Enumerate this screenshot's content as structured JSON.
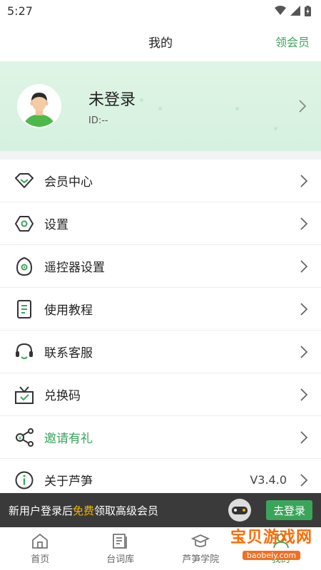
{
  "status_bar": {
    "time": "5:27"
  },
  "header": {
    "title": "我的",
    "action": "领会员"
  },
  "profile": {
    "name": "未登录",
    "id": "ID:--"
  },
  "menu": [
    {
      "label": "会员中心",
      "icon": "diamond-icon",
      "highlight": false,
      "value": ""
    },
    {
      "label": "设置",
      "icon": "hexagon-settings-icon",
      "highlight": false,
      "value": ""
    },
    {
      "label": "遥控器设置",
      "icon": "remote-icon",
      "highlight": false,
      "value": ""
    },
    {
      "label": "使用教程",
      "icon": "document-icon",
      "highlight": false,
      "value": ""
    },
    {
      "label": "联系客服",
      "icon": "headset-icon",
      "highlight": false,
      "value": ""
    },
    {
      "label": "兑换码",
      "icon": "gift-icon",
      "highlight": false,
      "value": ""
    },
    {
      "label": "邀请有礼",
      "icon": "share-icon",
      "highlight": true,
      "value": ""
    },
    {
      "label": "关于芦笋",
      "icon": "info-icon",
      "highlight": false,
      "value": "V3.4.0"
    }
  ],
  "promo": {
    "text_prefix": "新用户登录后",
    "text_highlight": "免费",
    "text_suffix": "领取高级会员",
    "button": "去登录"
  },
  "bottom_nav": [
    {
      "label": "首页",
      "icon": "home-icon"
    },
    {
      "label": "台词库",
      "icon": "script-library-icon"
    },
    {
      "label": "芦笋学院",
      "icon": "academy-icon"
    },
    {
      "label": "我的",
      "icon": "profile-icon",
      "active": true
    }
  ],
  "watermark": {
    "main": "宝贝游戏网",
    "sub": "baobeiy.com"
  },
  "colors": {
    "accent": "#3aa55a",
    "promo_bg": "#3a3a3a",
    "promo_highlight": "#f3b400"
  }
}
